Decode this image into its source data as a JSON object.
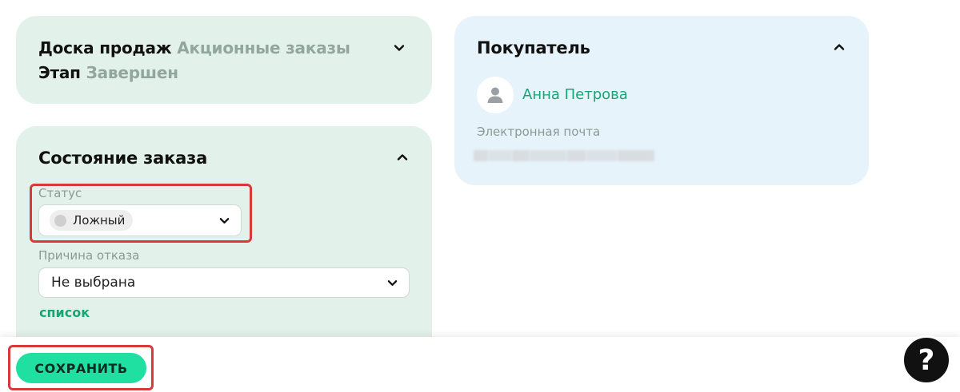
{
  "board": {
    "label": "Доска продаж",
    "value": "Акционные заказы",
    "stage_label": "Этап",
    "stage_value": "Завершен"
  },
  "order_state": {
    "title": "Состояние заказа",
    "status_label": "Статус",
    "status_value": "Ложный",
    "reason_label": "Причина отказа",
    "reason_value": "Не выбрана",
    "list_link": "список"
  },
  "buyer": {
    "title": "Покупатель",
    "name": "Анна Петрова",
    "email_label": "Электронная почта"
  },
  "actions": {
    "save_label": "СОХРАНИТЬ",
    "help_label": "?"
  },
  "colors": {
    "accent": "#1fe0a0",
    "link": "#1aa575",
    "card_green": "#e3f1eb",
    "card_blue": "#e6f3fa",
    "highlight": "#d83a3a"
  }
}
